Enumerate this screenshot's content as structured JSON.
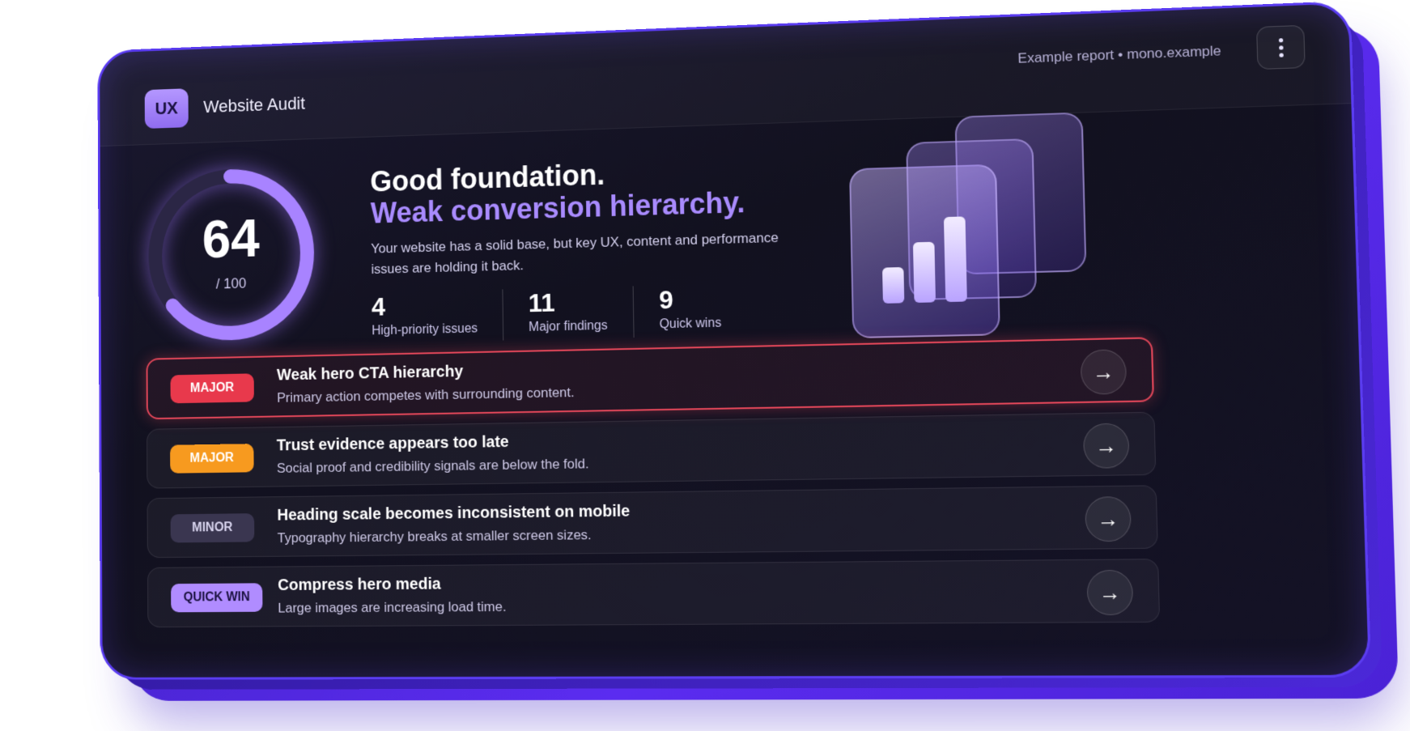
{
  "header": {
    "badge": "UX",
    "title": "Website Audit",
    "report_label": "Example report • mono.example"
  },
  "score": {
    "value": "64",
    "out_of": "/ 100",
    "fraction": 0.64
  },
  "summary": {
    "headline_1": "Good foundation.",
    "headline_2": "Weak conversion hierarchy.",
    "description": "Your website has a solid base, but key UX, content and performance issues are holding it back."
  },
  "stats": [
    {
      "value": "4",
      "label": "High-priority issues"
    },
    {
      "value": "11",
      "label": "Major findings"
    },
    {
      "value": "9",
      "label": "Quick wins"
    }
  ],
  "issues": [
    {
      "tag": "MAJOR",
      "title": "Weak hero CTA hierarchy",
      "subtitle": "Primary action competes with surrounding content.",
      "tag_color": "#e8394c"
    },
    {
      "tag": "MAJOR",
      "title": "Trust evidence appears too late",
      "subtitle": "Social proof and credibility signals are below the fold.",
      "tag_color": "#f79a1f"
    },
    {
      "tag": "MINOR",
      "title": "Heading scale becomes inconsistent on mobile",
      "subtitle": "Typography hierarchy breaks at smaller screen sizes.",
      "tag_color": "#3a3650"
    },
    {
      "tag": "QUICK WIN",
      "title": "Compress hero media",
      "subtitle": "Large images are increasing load time.",
      "tag_color": "#b08cff"
    }
  ],
  "colors": {
    "accent": "#a98bff",
    "card_bg": "#141226",
    "frame": "#5a3cf0",
    "critical": "#e4475a"
  },
  "icons": {
    "menu": "more-vertical-icon",
    "row_action": "arrow-right-icon",
    "illustration": "bar-chart-icon"
  }
}
